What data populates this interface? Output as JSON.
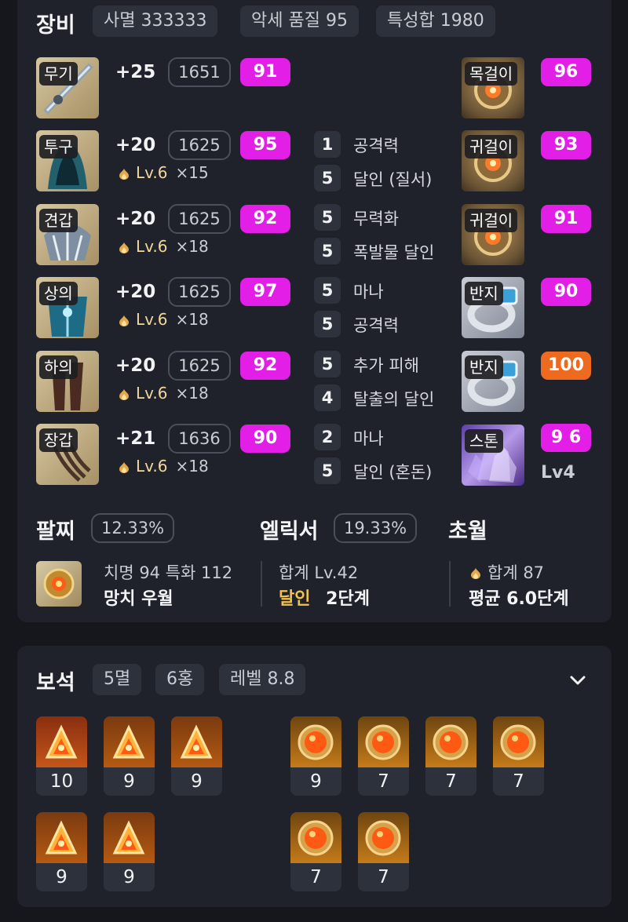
{
  "equipment": {
    "title": "장비",
    "chips": [
      "사멸 333333",
      "악세 품질 95",
      "특성합 1980"
    ],
    "gear": [
      {
        "slot": "무기",
        "plus": "+25",
        "ilvl": "1651",
        "quality": "91",
        "lv": "",
        "mult": ""
      },
      {
        "slot": "투구",
        "plus": "+20",
        "ilvl": "1625",
        "quality": "95",
        "lv": "Lv.6",
        "mult": "×15"
      },
      {
        "slot": "견갑",
        "plus": "+20",
        "ilvl": "1625",
        "quality": "92",
        "lv": "Lv.6",
        "mult": "×18"
      },
      {
        "slot": "상의",
        "plus": "+20",
        "ilvl": "1625",
        "quality": "97",
        "lv": "Lv.6",
        "mult": "×18"
      },
      {
        "slot": "하의",
        "plus": "+20",
        "ilvl": "1625",
        "quality": "92",
        "lv": "Lv.6",
        "mult": "×18"
      },
      {
        "slot": "장갑",
        "plus": "+21",
        "ilvl": "1636",
        "quality": "90",
        "lv": "Lv.6",
        "mult": "×18"
      }
    ],
    "engravings": [
      {
        "level": "1",
        "name": "공격력"
      },
      {
        "level": "5",
        "name": "달인 (질서)"
      },
      {
        "level": "5",
        "name": "무력화"
      },
      {
        "level": "5",
        "name": "폭발물 달인"
      },
      {
        "level": "5",
        "name": "마나"
      },
      {
        "level": "5",
        "name": "공격력"
      },
      {
        "level": "5",
        "name": "추가 피해"
      },
      {
        "level": "4",
        "name": "탈출의 달인"
      },
      {
        "level": "2",
        "name": "마나"
      },
      {
        "level": "5",
        "name": "달인 (혼돈)"
      }
    ],
    "accessories": [
      {
        "slot": "목걸이",
        "quality": "96",
        "color": "#e21ee7"
      },
      {
        "slot": "귀걸이",
        "quality": "93",
        "color": "#e21ee7"
      },
      {
        "slot": "귀걸이",
        "quality": "91",
        "color": "#e21ee7"
      },
      {
        "slot": "반지",
        "quality": "90",
        "color": "#e21ee7"
      },
      {
        "slot": "반지",
        "quality": "100",
        "color": "#ee6a1f"
      }
    ],
    "stone": {
      "slot": "스톤",
      "quality": "9 6",
      "level": "Lv4"
    },
    "bracelet": {
      "label": "팔찌",
      "value": "12.33%",
      "stats": "치명 94  특화 112",
      "effects": "망치  우월"
    },
    "elixir": {
      "label": "엘릭서",
      "value": "19.33%",
      "total": "합계 Lv.42",
      "set_name": "달인",
      "set_stage": "2단계"
    },
    "transcend": {
      "label": "초월",
      "total": "합계 87",
      "avg": "평균 6.0단계"
    }
  },
  "gems": {
    "title": "보석",
    "chips": [
      "5멸",
      "6홍",
      "레벨 8.8"
    ],
    "expand_icon": "chevron-down-icon",
    "row1_left": [
      {
        "lv": "10",
        "type": "fire"
      },
      {
        "lv": "9",
        "type": "fire"
      },
      {
        "lv": "9",
        "type": "fire"
      }
    ],
    "row1_right": [
      {
        "lv": "9",
        "type": "ruby"
      },
      {
        "lv": "7",
        "type": "ruby"
      },
      {
        "lv": "7",
        "type": "ruby"
      },
      {
        "lv": "7",
        "type": "ruby"
      }
    ],
    "row2_left": [
      {
        "lv": "9",
        "type": "fire"
      },
      {
        "lv": "9",
        "type": "fire"
      }
    ],
    "row2_right": [
      {
        "lv": "7",
        "type": "ruby"
      },
      {
        "lv": "7",
        "type": "ruby"
      }
    ]
  },
  "colors": {
    "quality_purple": "#e21ee7",
    "quality_orange": "#ee6a1f",
    "elixir_gold": "#f2c14e"
  }
}
